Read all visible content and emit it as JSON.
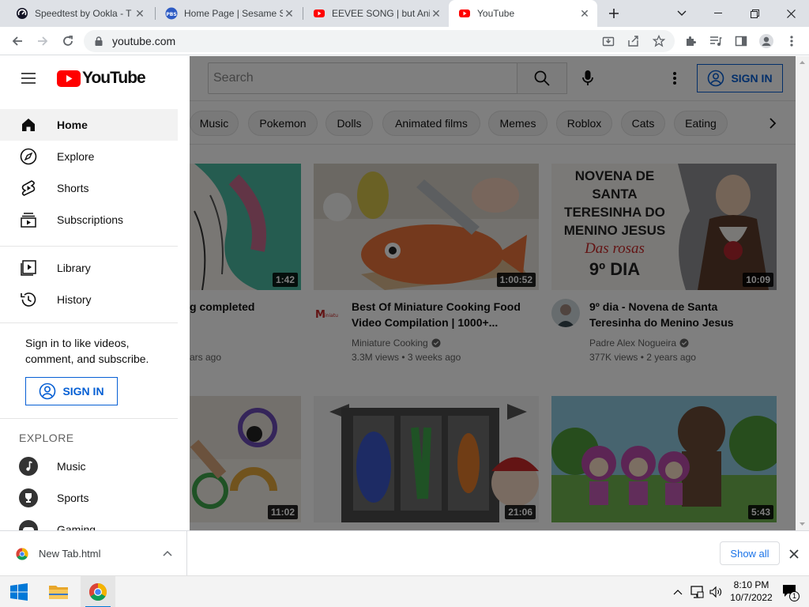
{
  "browser": {
    "tabs": [
      {
        "title": "Speedtest by Ookla - T"
      },
      {
        "title": "Home Page | Sesame St"
      },
      {
        "title": "EEVEE SONG | but Anim"
      },
      {
        "title": "YouTube"
      }
    ],
    "url": "youtube.com"
  },
  "youtube": {
    "logo_text": "YouTube",
    "search_placeholder": "Search",
    "sign_in": "SIGN IN",
    "chips": [
      "Music",
      "Pokemon",
      "Dolls",
      "Animated films",
      "Memes",
      "Roblox",
      "Cats",
      "Eating"
    ],
    "guide": {
      "main": [
        "Home",
        "Explore",
        "Shorts",
        "Subscriptions"
      ],
      "library": [
        "Library",
        "History"
      ],
      "signin_prompt": [
        "Sign in to like videos,",
        "comment, and subscribe."
      ],
      "signin_label": "SIGN IN",
      "explore_header": "EXPLORE",
      "explore": [
        "Music",
        "Sports",
        "Gaming"
      ]
    },
    "videos": [
      {
        "duration": "1:42",
        "title": [
          "g completed",
          ""
        ],
        "channel": "",
        "meta": "ars ago"
      },
      {
        "duration": "1:00:52",
        "title": [
          "Best Of Miniature Cooking Food",
          "Video Compilation | 1000+..."
        ],
        "channel": "Miniature Cooking",
        "meta": "3.3M views • 3 weeks ago",
        "thumb_text": []
      },
      {
        "duration": "10:09",
        "title": [
          "9º dia - Novena de Santa",
          "Teresinha do Menino Jesus"
        ],
        "channel": "Padre Alex Nogueira",
        "meta": "377K views • 2 years ago",
        "thumb_text": [
          "NOVENA DE",
          "SANTA",
          "TERESINHA DO",
          "MENINO JESUS",
          "Das rosas",
          "9º DIA"
        ]
      },
      {
        "duration": "11:02"
      },
      {
        "duration": "21:06"
      },
      {
        "duration": "5:43"
      }
    ]
  },
  "downloads": {
    "file": "New Tab.html",
    "show_all": "Show all"
  },
  "taskbar": {
    "time": "8:10 PM",
    "date": "10/7/2022",
    "notif_count": "1"
  },
  "colors": {
    "yt_red": "#ff0000",
    "link_blue": "#065fd4",
    "chrome_blue": "#1a73e8"
  }
}
